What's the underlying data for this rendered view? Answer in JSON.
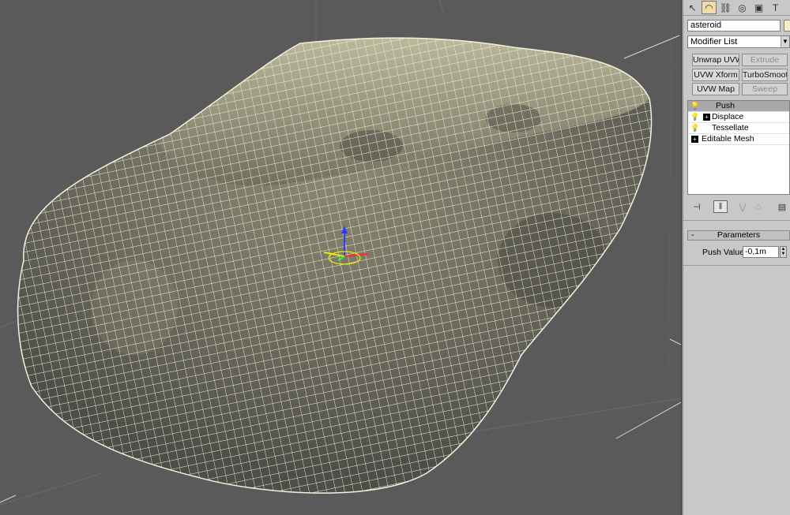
{
  "viewport": {
    "background": "#5a5a5a",
    "object_name": "asteroid",
    "gizmo": "transform-gizmo"
  },
  "panel": {
    "toolbar": [
      {
        "icon": "create-icon",
        "glyph": "↖"
      },
      {
        "icon": "modify-icon",
        "glyph": "◠"
      },
      {
        "icon": "hierarchy-icon",
        "glyph": "⛓"
      },
      {
        "icon": "motion-icon",
        "glyph": "◎"
      },
      {
        "icon": "display-icon",
        "glyph": "▣"
      },
      {
        "icon": "utilities-icon",
        "glyph": "T"
      }
    ],
    "object_name_value": "asteroid",
    "object_color": "#f4eec6",
    "modifier_list": "Modifier List",
    "buttons": {
      "unwrap": "Unwrap UVW",
      "extrude": "Extrude",
      "uvw_xform": "UVW Xform",
      "turbosmooth": "TurboSmooth",
      "uvw_map": "UVW Map",
      "sweep": "Sweep"
    },
    "stack": [
      {
        "label": "Push",
        "selected": true,
        "bulb": true,
        "plus": false
      },
      {
        "label": "Displace",
        "selected": false,
        "bulb": true,
        "plus": true
      },
      {
        "label": "Tessellate",
        "selected": false,
        "bulb": true,
        "plus": false
      },
      {
        "label": "Editable Mesh",
        "selected": false,
        "bulb": false,
        "plus": true
      }
    ],
    "parameters": {
      "rollout_title": "Parameters",
      "minus": "-",
      "push_value_label": "Push Value:",
      "push_value": "-0,1m"
    }
  }
}
